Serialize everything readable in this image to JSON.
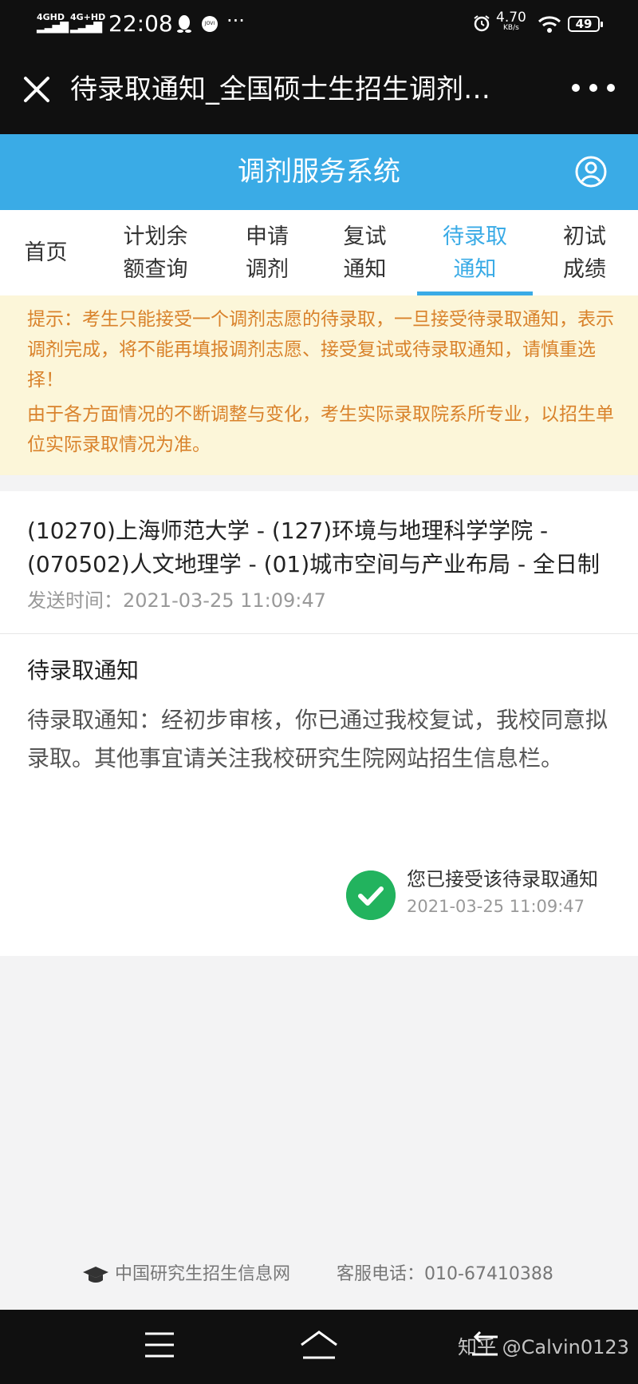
{
  "status_bar": {
    "sim1": "4GHD",
    "sim2": "4G+HD",
    "time": "22:08",
    "more": "···",
    "jovi": "JOVI",
    "speed_value": "4.70",
    "speed_unit": "KB/s",
    "battery": "49"
  },
  "browser": {
    "title": "待录取通知_全国硕士生招生调剂…"
  },
  "app": {
    "name": "调剂服务系统",
    "accent": "#3aabe6"
  },
  "tabs": [
    {
      "line1": "首页",
      "line2": ""
    },
    {
      "line1": "计划余",
      "line2": "额查询"
    },
    {
      "line1": "申请",
      "line2": "调剂"
    },
    {
      "line1": "复试",
      "line2": "通知"
    },
    {
      "line1": "待录取",
      "line2": "通知",
      "active": true
    },
    {
      "line1": "初试",
      "line2": "成绩"
    }
  ],
  "notice": {
    "para1": "提示：考生只能接受一个调剂志愿的待录取，一旦接受待录取通知，表示调剂完成，将不能再填报调剂志愿、接受复试或待录取通知，请慎重选择！",
    "para2": "由于各方面情况的不断调整与变化，考生实际录取院系所专业，以招生单位实际录取情况为准。"
  },
  "admission": {
    "program": "(10270)上海师范大学 - (127)环境与地理科学学院 - (070502)人文地理学 - (01)城市空间与产业布局 - 全日制",
    "sent_label": "发送时间：",
    "sent_time": "2021-03-25 11:09:47"
  },
  "notice_detail": {
    "heading": "待录取通知",
    "body": "待录取通知：经初步审核，你已通过我校复试，我校同意拟录取。其他事宜请关注我校研究生院网站招生信息栏。",
    "accepted_text": "您已接受该待录取通知",
    "accepted_time": "2021-03-25 11:09:47",
    "check_color": "#22b35e"
  },
  "footer": {
    "site": "中国研究生招生信息网",
    "phone_label": "客服电话：",
    "phone": "010-67410388"
  },
  "watermark": "知乎 @Calvin0123"
}
